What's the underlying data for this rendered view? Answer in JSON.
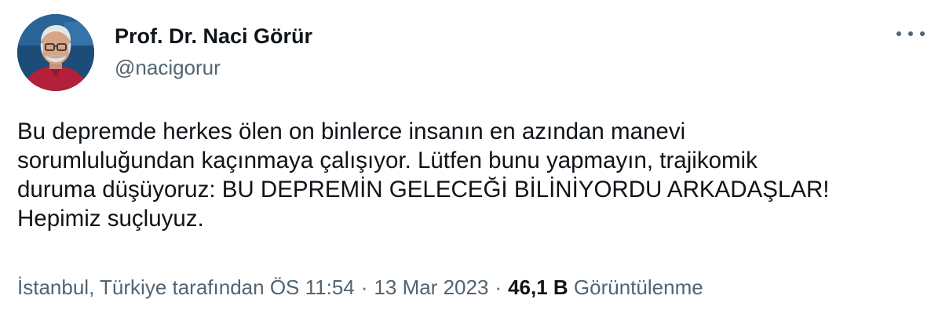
{
  "author": {
    "display_name": "Prof. Dr. Naci Görür",
    "handle": "@nacigorur",
    "avatar_icon": "profile-photo"
  },
  "tweet": {
    "text": "Bu depremde herkes ölen on binlerce insanın en azından manevi\nsorumluluğundan kaçınmaya çalışıyor. Lütfen bunu yapmayın, trajikomik\nduruma düşüyoruz: BU DEPREMİN GELECEĞİ BİLİNİYORDU ARKADAŞLAR!\nHepimiz suçluyuz."
  },
  "meta": {
    "location_time": "İstanbul, Türkiye tarafından ÖS 11:54",
    "separator": "·",
    "date": "13 Mar 2023",
    "views_count": "46,1 B",
    "views_label": "Görüntülenme"
  },
  "menu": {
    "icon": "more-icon"
  },
  "colors": {
    "text_primary": "#0f1419",
    "text_secondary": "#536471",
    "background": "#ffffff"
  }
}
